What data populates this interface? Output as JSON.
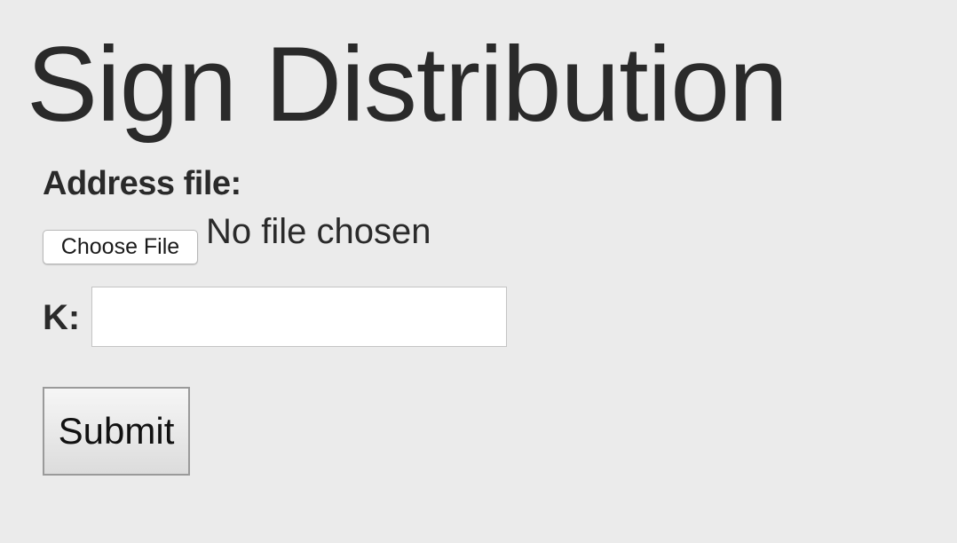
{
  "page": {
    "title": "Sign Distribution"
  },
  "form": {
    "address_label": "Address file:",
    "choose_file_label": "Choose File",
    "file_status": "No file chosen",
    "k_label": "K:",
    "k_value": "",
    "submit_label": "Submit"
  },
  "colors": {
    "background": "#ebebeb",
    "text": "#2a2a2a"
  }
}
